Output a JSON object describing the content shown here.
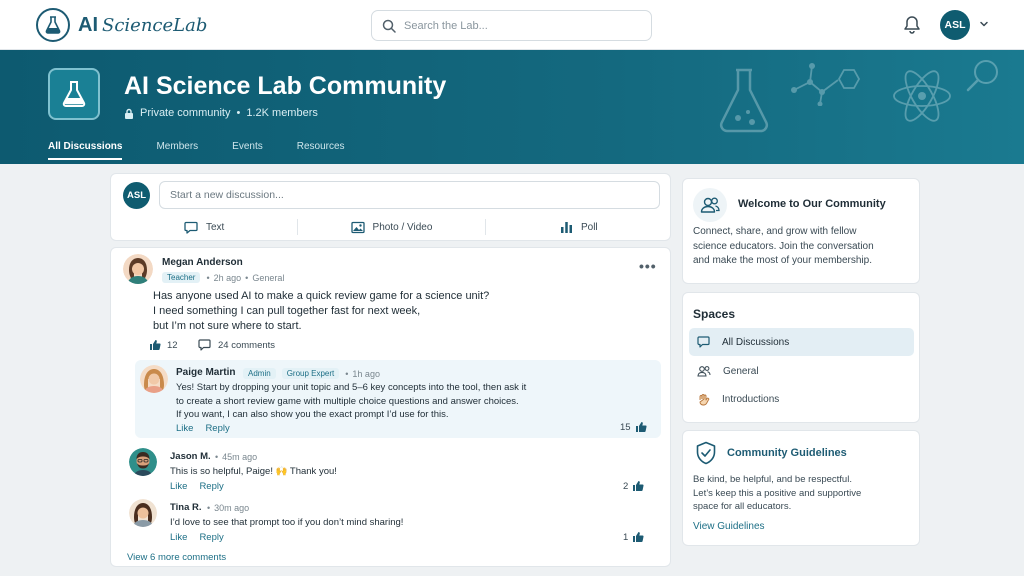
{
  "app": {
    "logo_ai": "AI",
    "logo_rest": "ScienceLab",
    "search_placeholder": "Search the Lab...",
    "user_initials": "ASL"
  },
  "banner": {
    "title": "AI Science Lab Community",
    "privacy": "Private community",
    "members": "1.2K members",
    "tabs": [
      {
        "label": "All Discussions",
        "active": true
      },
      {
        "label": "Members",
        "active": false
      },
      {
        "label": "Events",
        "active": false
      },
      {
        "label": "Resources",
        "active": false
      }
    ]
  },
  "composer": {
    "avatar": "ASL",
    "placeholder": "Start a new discussion...",
    "actions": [
      {
        "label": "Text",
        "icon": "chat-bubble-icon"
      },
      {
        "label": "Photo / Video",
        "icon": "image-icon"
      },
      {
        "label": "Poll",
        "icon": "poll-icon"
      }
    ]
  },
  "post": {
    "author": "Megan Anderson",
    "role": "Teacher",
    "time": "2h ago",
    "space": "General",
    "body": [
      "Has anyone used AI to make a quick review game for a science unit?",
      "I need something I can pull together fast for next week,",
      "but I’m not sure where to start."
    ],
    "likes": "12",
    "comments": "24 comments",
    "top_reply": {
      "author": "Paige Martin",
      "badges": [
        "Admin",
        "Group Expert"
      ],
      "time": "1h ago",
      "body": [
        "Yes! Start by dropping your unit topic and 5–6 key concepts into the tool, then ask it",
        "to create a short review game with multiple choice questions and answer choices.",
        "If you want, I can also show you the exact prompt I’d use for this."
      ],
      "like_label": "Like",
      "reply_label": "Reply",
      "likes": "15"
    },
    "replies": [
      {
        "author": "Jason M.",
        "time": "45m ago",
        "body": "This is so helpful, Paige! 🙌  Thank you!",
        "like_label": "Like",
        "reply_label": "Reply",
        "likes": "2"
      },
      {
        "author": "Tina R.",
        "time": "30m ago",
        "body": "I’d love to see that prompt too if you don’t mind sharing!",
        "like_label": "Like",
        "reply_label": "Reply",
        "likes": "1"
      }
    ],
    "view_more": "View 6 more comments"
  },
  "sidebar": {
    "welcome": {
      "title": "Welcome to Our Community",
      "text": [
        "Connect, share, and grow with fellow",
        "science educators. Join the conversation",
        "and make the most of your membership."
      ]
    },
    "spaces": {
      "title": "Spaces",
      "items": [
        {
          "label": "All Discussions",
          "icon": "chat-bubble-icon",
          "active": true
        },
        {
          "label": "General",
          "icon": "people-icon",
          "active": false
        },
        {
          "label": "Introductions",
          "icon": "wave-hand-icon",
          "active": false
        }
      ]
    },
    "guidelines": {
      "title": "Community Guidelines",
      "text": [
        "Be kind, be helpful, and be respectful.",
        "Let’s keep this a positive and supportive",
        "space for all educators."
      ],
      "link": "View Guidelines"
    }
  },
  "colors": {
    "brand": "#0f5c70",
    "accent": "#1d6f86",
    "banner_start": "#0d5a70",
    "banner_end": "#1a7a90"
  }
}
